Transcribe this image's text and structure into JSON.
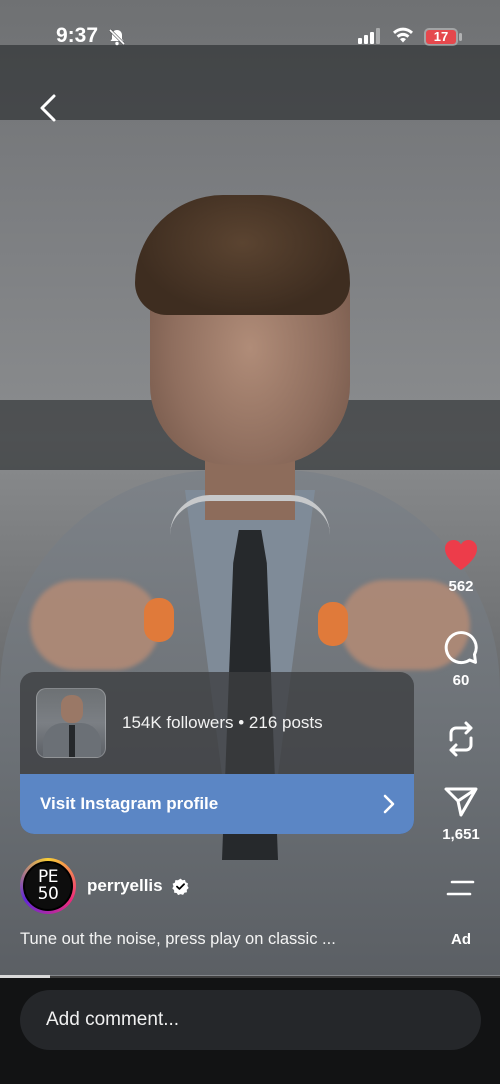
{
  "status_bar": {
    "time": "9:37",
    "battery": "17",
    "battery_color": "#e5484d"
  },
  "icons": {
    "back": "chevron-left-icon",
    "bell": "bell-slash-icon",
    "like": "heart-icon",
    "comment": "comment-bubble-icon",
    "repost": "repost-icon",
    "share": "send-icon",
    "menu": "menu-icon",
    "verified": "verified-badge-icon"
  },
  "actions": {
    "likes": "562",
    "comments": "60",
    "shares": "1,651",
    "like_color": "#ed3c4a"
  },
  "profile_card": {
    "followers": "154K followers",
    "separator": " • ",
    "posts": "216 posts",
    "visit_label": "Visit Instagram profile",
    "button_color": "#5b86c5"
  },
  "author": {
    "avatar_line1": "PE",
    "avatar_line2": "50",
    "username": "perryellis",
    "caption": "Tune out the noise, press play on classic ...",
    "ad_label": "Ad"
  },
  "video": {
    "progress": 0.1
  },
  "comment": {
    "placeholder": "Add comment..."
  }
}
